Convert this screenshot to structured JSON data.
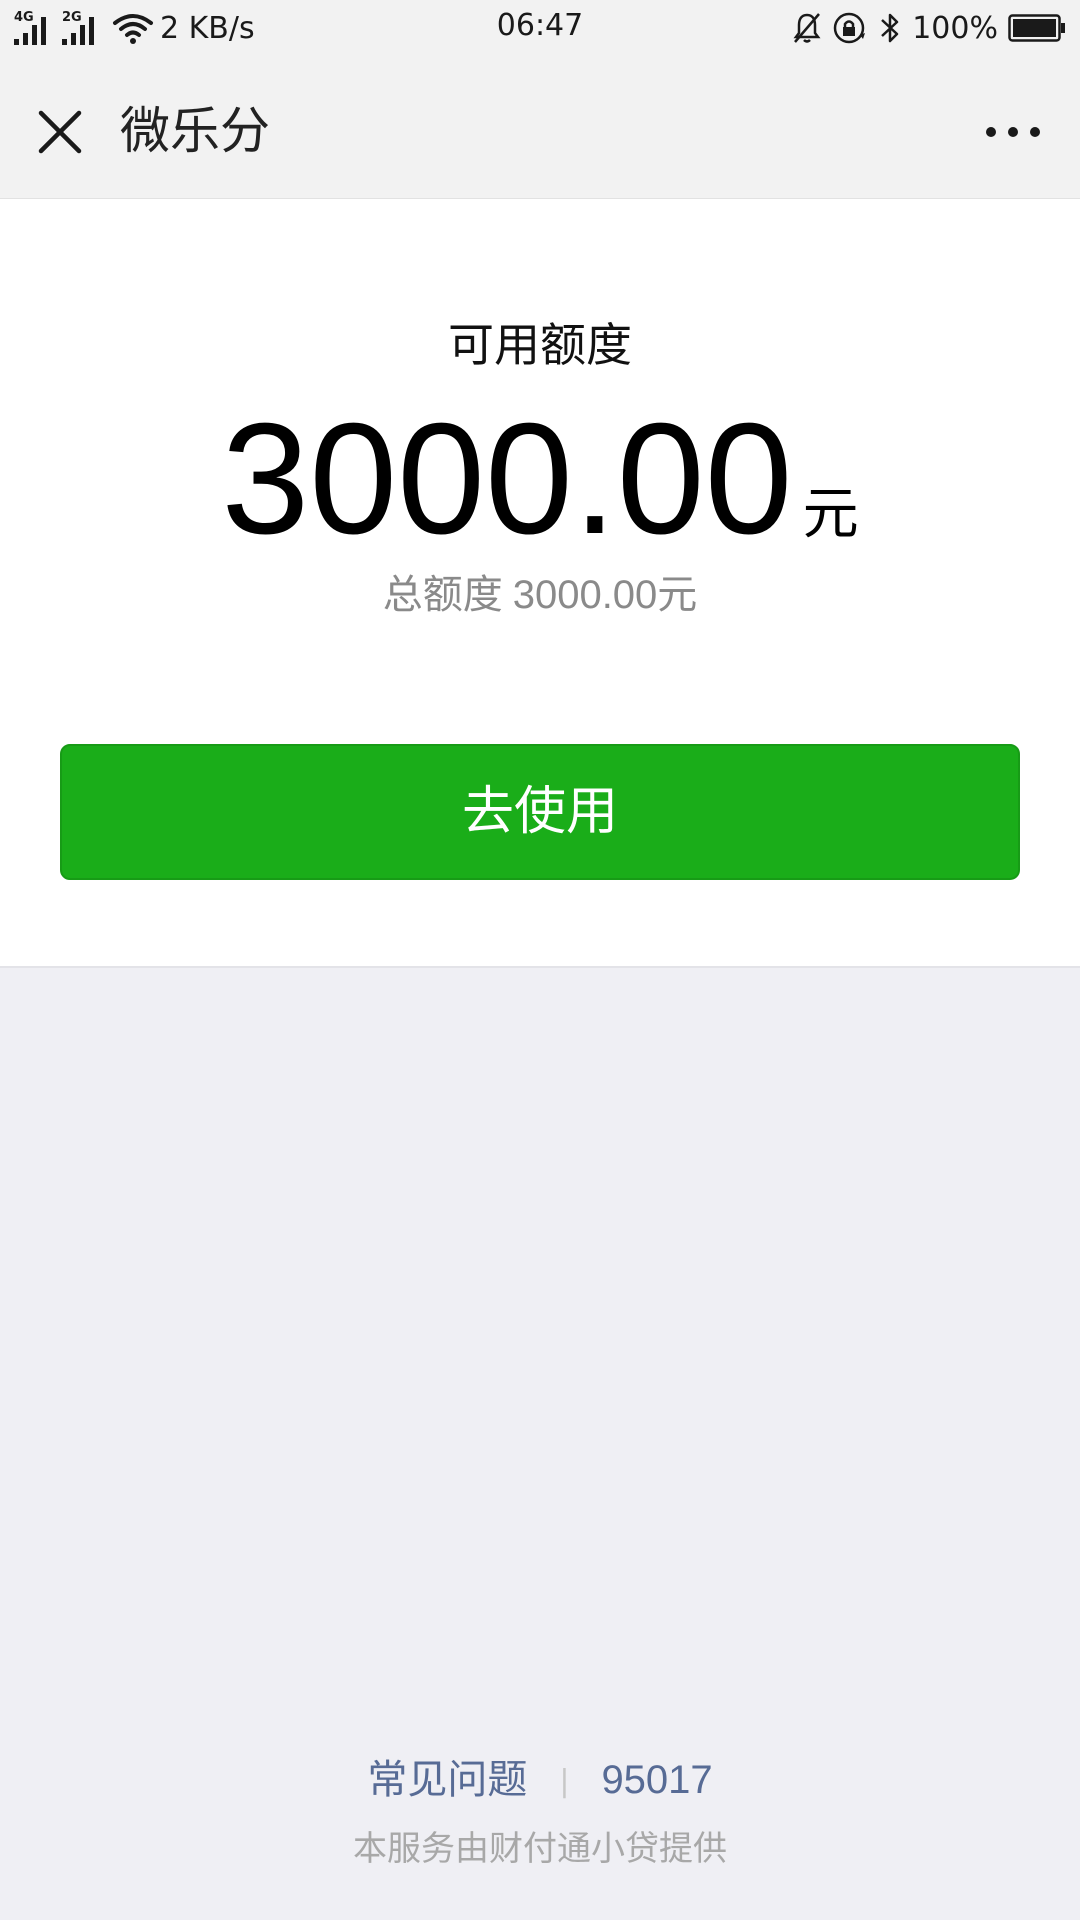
{
  "status_bar": {
    "signal_1_label": "4G",
    "signal_2_label": "2G",
    "net_speed": "2 KB/s",
    "time": "06:47",
    "battery_percent": "100%"
  },
  "nav": {
    "title": "微乐分"
  },
  "card": {
    "label": "可用额度",
    "amount": "3000.00",
    "unit": "元",
    "total_label": "总额度",
    "total_value": "3000.00元",
    "button_label": "去使用"
  },
  "footer": {
    "faq_label": "常见问题",
    "separator": "|",
    "phone": "95017",
    "provider_text": "本服务由财付通小贷提供"
  },
  "colors": {
    "button_green": "#1aad19",
    "link_blue": "#576b95",
    "page_background": "#efeff4"
  }
}
